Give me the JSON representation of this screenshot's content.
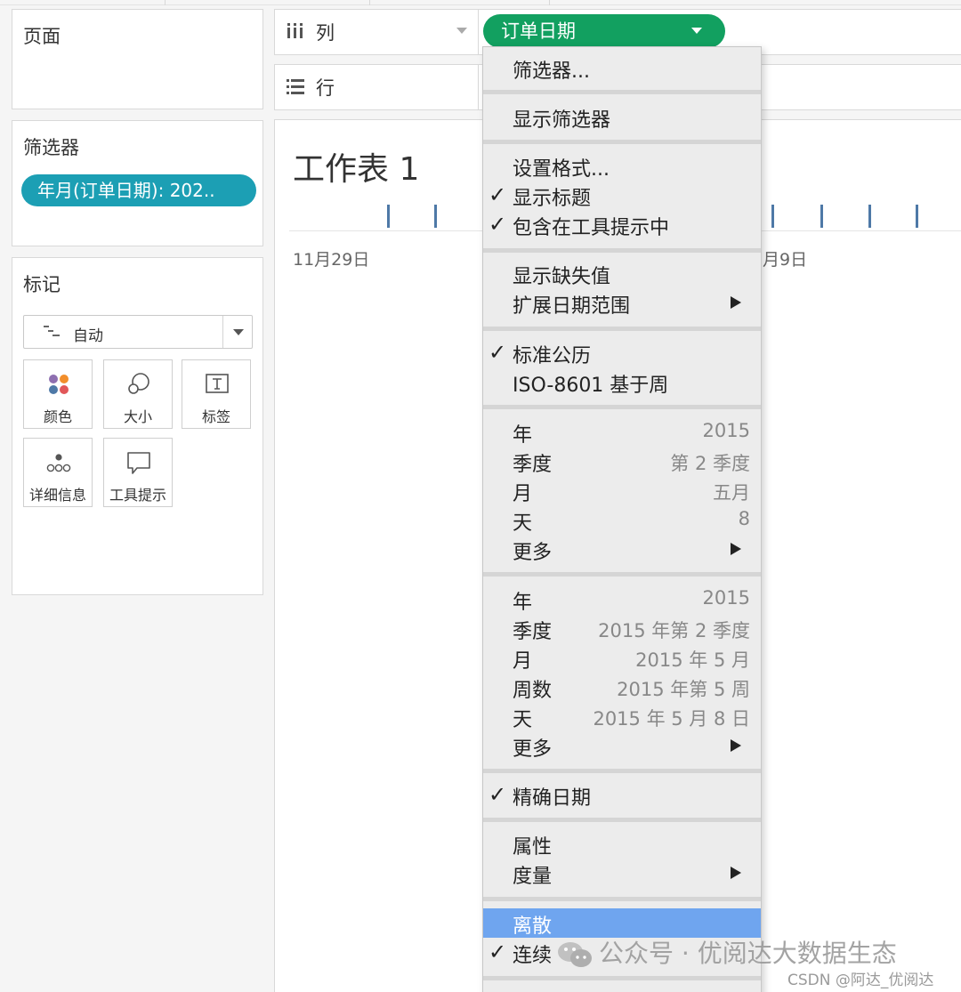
{
  "pages_panel": {
    "title": "页面"
  },
  "filters_panel": {
    "title": "筛选器",
    "filter_pill": "年月(订单日期): 202.."
  },
  "marks_panel": {
    "title": "标记",
    "mark_type": "自动",
    "cards": [
      {
        "label": "颜色",
        "icon": "color-icon"
      },
      {
        "label": "大小",
        "icon": "size-icon"
      },
      {
        "label": "标签",
        "icon": "label-icon"
      },
      {
        "label": "详细信息",
        "icon": "detail-icon"
      },
      {
        "label": "工具提示",
        "icon": "tooltip-icon"
      }
    ]
  },
  "shelves": {
    "columns": {
      "label": "列",
      "icon": "columns-icon"
    },
    "rows": {
      "label": "行",
      "icon": "rows-icon"
    }
  },
  "field_pill": {
    "label": "订单日期",
    "color": "#12a060"
  },
  "worksheet": {
    "title": "工作表 1",
    "axis_labels": [
      "11月29日",
      "月9日"
    ],
    "tick_color": "#4e79a7"
  },
  "menu": {
    "items": [
      {
        "label": "筛选器..."
      },
      {
        "label": "显示筛选器"
      },
      {
        "label": "设置格式..."
      },
      {
        "label": "显示标题",
        "checked": true
      },
      {
        "label": "包含在工具提示中",
        "checked": true
      },
      {
        "label": "显示缺失值"
      },
      {
        "label": "扩展日期范围",
        "submenu": true
      },
      {
        "label": "标准公历",
        "checked": true
      },
      {
        "label": "ISO-8601 基于周"
      },
      {
        "label": "年",
        "value": "2015"
      },
      {
        "label": "季度",
        "value": "第 2 季度"
      },
      {
        "label": "月",
        "value": "五月"
      },
      {
        "label": "天",
        "value": "8"
      },
      {
        "label": "更多",
        "submenu": true
      },
      {
        "label": "年",
        "value": "2015"
      },
      {
        "label": "季度",
        "value": "2015 年第 2 季度"
      },
      {
        "label": "月",
        "value": "2015 年 5 月"
      },
      {
        "label": "周数",
        "value": "2015 年第 5 周"
      },
      {
        "label": "天",
        "value": "2015 年 5 月 8 日"
      },
      {
        "label": "更多",
        "submenu": true
      },
      {
        "label": "精确日期",
        "checked": true
      },
      {
        "label": "属性"
      },
      {
        "label": "度量",
        "submenu": true
      },
      {
        "label": "离散",
        "highlighted": true
      },
      {
        "label": "连续",
        "checked": true
      }
    ],
    "highlight_color": "#6fa5ef"
  },
  "watermark": {
    "text": "公众号 · 优阅达大数据生态",
    "credit": "CSDN @阿达_优阅达",
    "icon": "wechat-icon"
  }
}
